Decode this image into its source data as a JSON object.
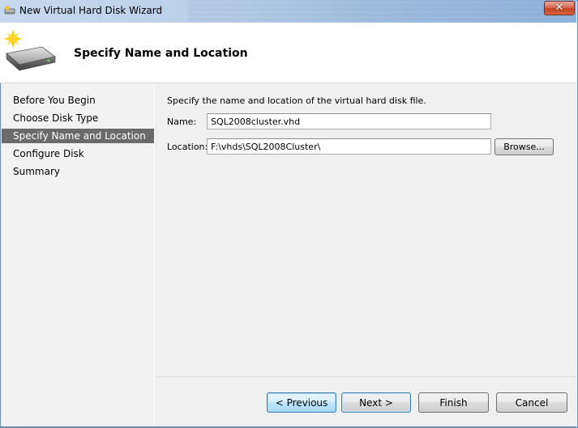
{
  "window": {
    "title": "New Virtual Hard Disk Wizard",
    "icon": "disk-wizard-icon",
    "close_label": "✕"
  },
  "header": {
    "title": "Specify Name and Location",
    "icon": "hard-disk-sparkle-icon"
  },
  "sidebar": {
    "items": [
      {
        "label": "Before You Begin",
        "active": false
      },
      {
        "label": "Choose Disk Type",
        "active": false
      },
      {
        "label": "Specify Name and Location",
        "active": true
      },
      {
        "label": "Configure Disk",
        "active": false
      },
      {
        "label": "Summary",
        "active": false
      }
    ]
  },
  "main": {
    "intro": "Specify the name and location of the virtual hard disk file.",
    "name_label": "Name:",
    "name_value": "SQL2008cluster.vhd",
    "location_label": "Location:",
    "location_value": "F:\\vhds\\SQL2008Cluster\\",
    "browse_label": "Browse..."
  },
  "footer": {
    "previous_label": "< Previous",
    "next_label": "Next >",
    "finish_label": "Finish",
    "cancel_label": "Cancel"
  },
  "colors": {
    "sidebar_active": "#6b6b6b",
    "content_bg": "#f0f0f0",
    "title_bar": "#b8cfe8"
  }
}
